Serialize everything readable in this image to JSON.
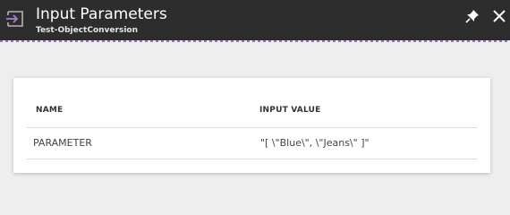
{
  "blade": {
    "title": "Input Parameters",
    "subtitle": "Test-ObjectConversion",
    "icon": "input-parameters-icon",
    "actions": {
      "pin_icon": "pin-icon",
      "close_icon": "close-icon"
    },
    "colors": {
      "header_bg": "#2d2d2d",
      "accent": "#9b6fc2",
      "page_bg": "#eeeeee"
    }
  },
  "table": {
    "columns": [
      "NAME",
      "INPUT VALUE"
    ],
    "rows": [
      {
        "name": "PARAMETER",
        "value": "\"[ \\\"Blue\\\", \\\"Jeans\\\" ]\""
      }
    ]
  }
}
